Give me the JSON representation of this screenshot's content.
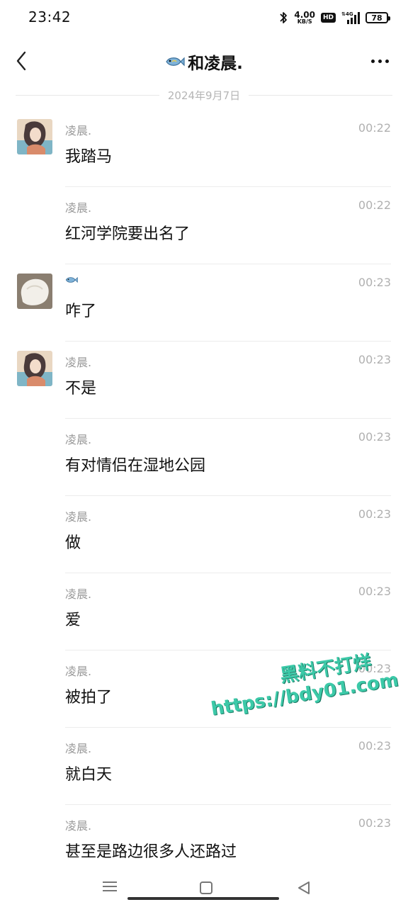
{
  "status_bar": {
    "time": "23:42",
    "speed_value": "4.00",
    "speed_unit": "KB/S",
    "hd_label": "HD",
    "network_label": "4G",
    "battery": "78"
  },
  "header": {
    "title": "和凌晨.",
    "title_icon": "fish-emoji-icon"
  },
  "date_divider": "2024年9月7日",
  "messages": [
    {
      "sender": "凌晨.",
      "time": "00:22",
      "text": "我踏马",
      "avatar": "anime-girl"
    },
    {
      "sender": "凌晨.",
      "time": "00:22",
      "text": "红河学院要出名了",
      "avatar": ""
    },
    {
      "sender": "",
      "sender_icon": "fish-emoji-icon",
      "time": "00:23",
      "text": "咋了",
      "avatar": "white-cat"
    },
    {
      "sender": "凌晨.",
      "time": "00:23",
      "text": "不是",
      "avatar": "anime-girl"
    },
    {
      "sender": "凌晨.",
      "time": "00:23",
      "text": "有对情侣在湿地公园",
      "avatar": ""
    },
    {
      "sender": "凌晨.",
      "time": "00:23",
      "text": "做",
      "avatar": ""
    },
    {
      "sender": "凌晨.",
      "time": "00:23",
      "text": "爱",
      "avatar": ""
    },
    {
      "sender": "凌晨.",
      "time": "00:23",
      "text": "被拍了",
      "avatar": ""
    },
    {
      "sender": "凌晨.",
      "time": "00:23",
      "text": "就白天",
      "avatar": ""
    },
    {
      "sender": "凌晨.",
      "time": "00:23",
      "text": "甚至是路边很多人还路过",
      "avatar": ""
    }
  ],
  "watermark": {
    "line1": "黑料不打烊",
    "line2": "https://bdy01.com"
  },
  "colors": {
    "watermark": "#3cc9a8",
    "meta_text": "#9a9a9a",
    "divider": "#ececec"
  }
}
